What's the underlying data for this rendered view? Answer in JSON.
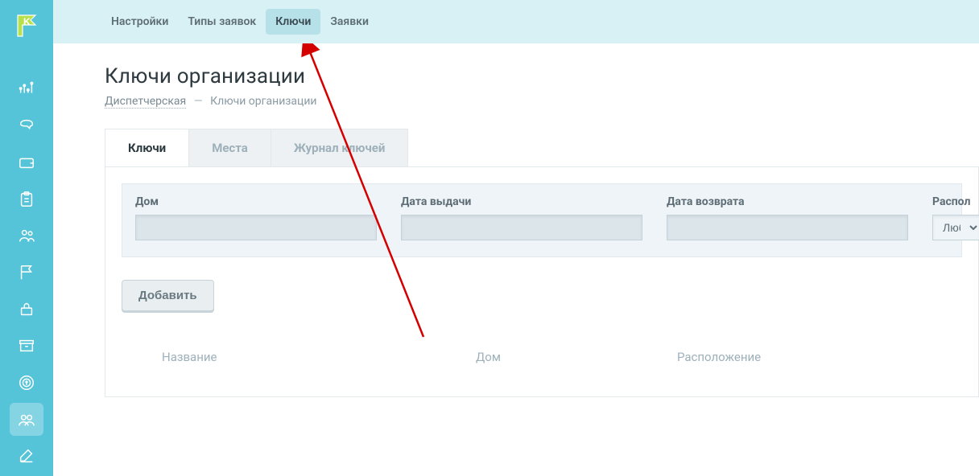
{
  "topnav": {
    "items": [
      {
        "label": "Настройки"
      },
      {
        "label": "Типы заявок"
      },
      {
        "label": "Ключи"
      },
      {
        "label": "Заявки"
      }
    ],
    "active_index": 2
  },
  "page": {
    "title": "Ключи организации",
    "breadcrumb_root": "Диспетчерская",
    "breadcrumb_sep": "—",
    "breadcrumb_current": "Ключи организации"
  },
  "tabs": {
    "items": [
      {
        "label": "Ключи"
      },
      {
        "label": "Места"
      },
      {
        "label": "Журнал ключей"
      }
    ],
    "active_index": 0
  },
  "filters": {
    "house_label": "Дом",
    "issued_label": "Дата выдачи",
    "returned_label": "Дата возврата",
    "location_label": "Распол",
    "location_value": "Любое"
  },
  "buttons": {
    "add": "Добавить"
  },
  "table": {
    "col_name": "Название",
    "col_house": "Дом",
    "col_location": "Расположение"
  },
  "annotation": {
    "arrow_color": "#d40000"
  }
}
